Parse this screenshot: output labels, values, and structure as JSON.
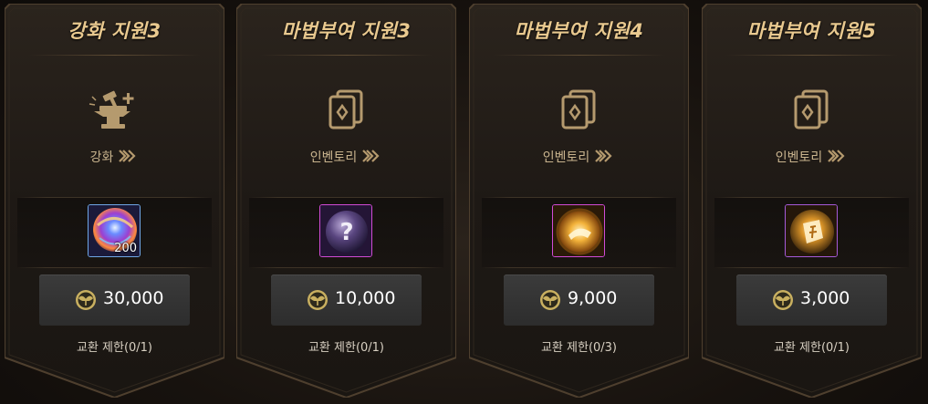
{
  "cards": [
    {
      "title": "강화 지원3",
      "link_label": "강화",
      "link_icon": "anvil-hammer-plus-icon",
      "item_icon": "enhancement-orb-icon",
      "item_count": "200",
      "price": "30,000",
      "price_icon": "sprout-coin-icon",
      "limit": "교환 제한(0/1)"
    },
    {
      "title": "마법부여 지원3",
      "link_label": "인벤토리",
      "link_icon": "cards-inventory-icon",
      "item_icon": "mystery-orb-icon",
      "item_count": "",
      "price": "10,000",
      "price_icon": "sprout-coin-icon",
      "limit": "교환 제한(0/1)"
    },
    {
      "title": "마법부여 지원4",
      "link_label": "인벤토리",
      "link_icon": "cards-inventory-icon",
      "item_icon": "golden-scroll-orb-icon",
      "item_count": "",
      "price": "9,000",
      "price_icon": "sprout-coin-icon",
      "limit": "교환 제한(0/3)"
    },
    {
      "title": "마법부여 지원5",
      "link_label": "인벤토리",
      "link_icon": "cards-inventory-icon",
      "item_icon": "golden-rune-stone-icon",
      "item_count": "",
      "price": "3,000",
      "price_icon": "sprout-coin-icon",
      "limit": "교환 제한(0/1)"
    }
  ],
  "colors": {
    "title": "#e9c98f",
    "frame_border": "#5a4a36",
    "price_bg": "#333333",
    "coin": "#c9b060"
  }
}
